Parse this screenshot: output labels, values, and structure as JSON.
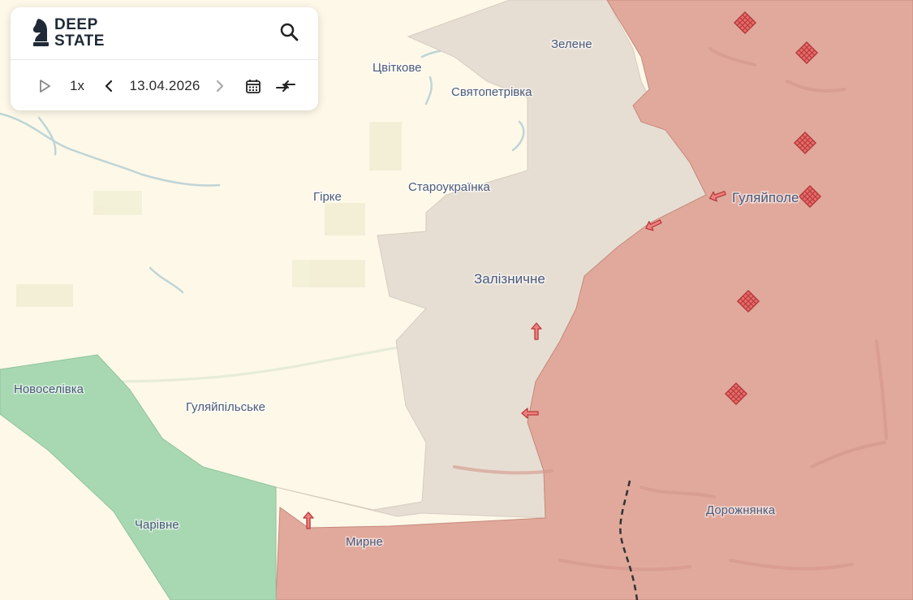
{
  "app": {
    "logo_line1": "DEEP",
    "logo_line2": "STATE"
  },
  "toolbar": {
    "speed": "1x",
    "date": "13.04.2026"
  },
  "icons": {
    "logo": "knight-chess-icon",
    "search": "search-icon",
    "play": "play-icon",
    "prev": "chevron-left-icon",
    "next": "chevron-right-icon",
    "calendar": "calendar-icon",
    "compare": "compare-arrows-icon",
    "airfield": "red-diamond-grid-marker",
    "attack": "red-arrow-marker"
  },
  "map": {
    "colors": {
      "background": "#fdf8e8",
      "occupied": "#e0a99c",
      "gray_zone": "#e7ded3",
      "liberated": "#a8d8b2",
      "water": "#a9c7cf",
      "marker": "#e05252"
    },
    "places": [
      "Цвіткове",
      "Зелене",
      "Святопетрівка",
      "Гірке",
      "Староукраїнка",
      "Гуляйполе",
      "Залізничне",
      "Новоселівка",
      "Гуляйпільське",
      "Чарівне",
      "Мирне",
      "Дорожнянка"
    ]
  }
}
